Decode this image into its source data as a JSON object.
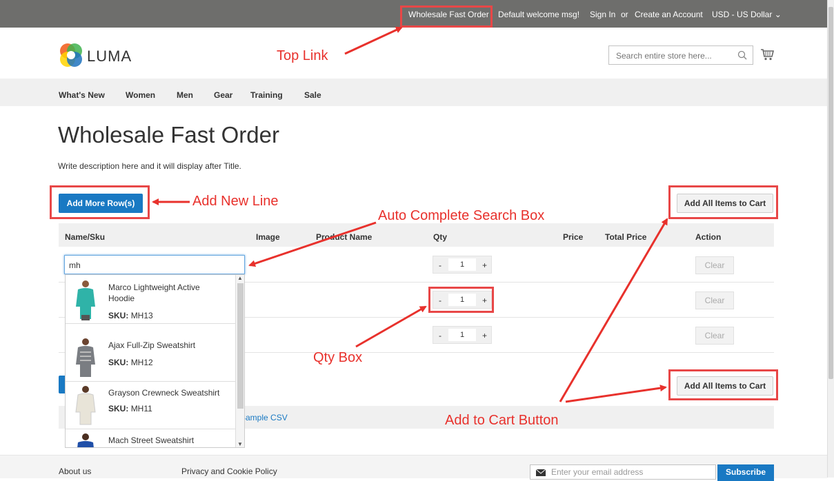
{
  "top_links": {
    "wholesale": "Wholesale Fast Order",
    "welcome": "Default welcome msg!",
    "sign_in": "Sign In",
    "or": "or",
    "create_account": "Create an Account",
    "currency": "USD - US Dollar",
    "currency_icon": "chevron-down-icon"
  },
  "logo": {
    "text": "LUMA"
  },
  "search": {
    "placeholder": "Search entire store here..."
  },
  "nav": [
    "What's New",
    "Women",
    "Men",
    "Gear",
    "Training",
    "Sale"
  ],
  "page": {
    "title": "Wholesale Fast Order",
    "description": "Write description here and it will display after Title."
  },
  "buttons": {
    "add_more_rows": "Add More Row(s)",
    "add_all_top": "Add All Items to Cart",
    "add_all_bottom": "Add All Items to Cart",
    "clear": "Clear",
    "subscribe": "Subscribe"
  },
  "table": {
    "headers": [
      "Name/Sku",
      "Image",
      "Product Name",
      "Qty",
      "Price",
      "Total Price",
      "Action"
    ],
    "first_input_value": "mh",
    "rows": [
      {
        "qty": "1",
        "minus": "-",
        "plus": "+"
      },
      {
        "qty": "1",
        "minus": "-",
        "plus": "+"
      },
      {
        "qty": "1",
        "minus": "-",
        "plus": "+"
      }
    ]
  },
  "autocomplete": [
    {
      "name": "Marco Lightweight Active Hoodie",
      "sku_label": "SKU:",
      "sku": "MH13",
      "shirt_color": "#2fb3a8"
    },
    {
      "name": "Ajax Full-Zip Sweatshirt",
      "sku_label": "SKU:",
      "sku": "MH12",
      "shirt_color": "#7a7d82"
    },
    {
      "name": "Grayson Crewneck Sweatshirt",
      "sku_label": "SKU:",
      "sku": "MH11",
      "shirt_color": "#e8e4d8"
    },
    {
      "name": "Mach Street Sweatshirt",
      "shirt_color": "#1f4fa8"
    }
  ],
  "sample_csv": "Sample CSV",
  "annotations": {
    "top_link": "Top Link",
    "add_new_line": "Add New Line",
    "auto_complete": "Auto Complete Search Box",
    "qty_box": "Qty Box",
    "add_to_cart": "Add to Cart Button"
  },
  "footer": {
    "about": "About us",
    "privacy": "Privacy and Cookie Policy",
    "email_placeholder": "Enter your email address"
  },
  "colors": {
    "top_bar": "#6e6e6c",
    "button_blue": "#1979c3",
    "annotation_red": "#e8312c",
    "logo_orange": "#f26322"
  }
}
